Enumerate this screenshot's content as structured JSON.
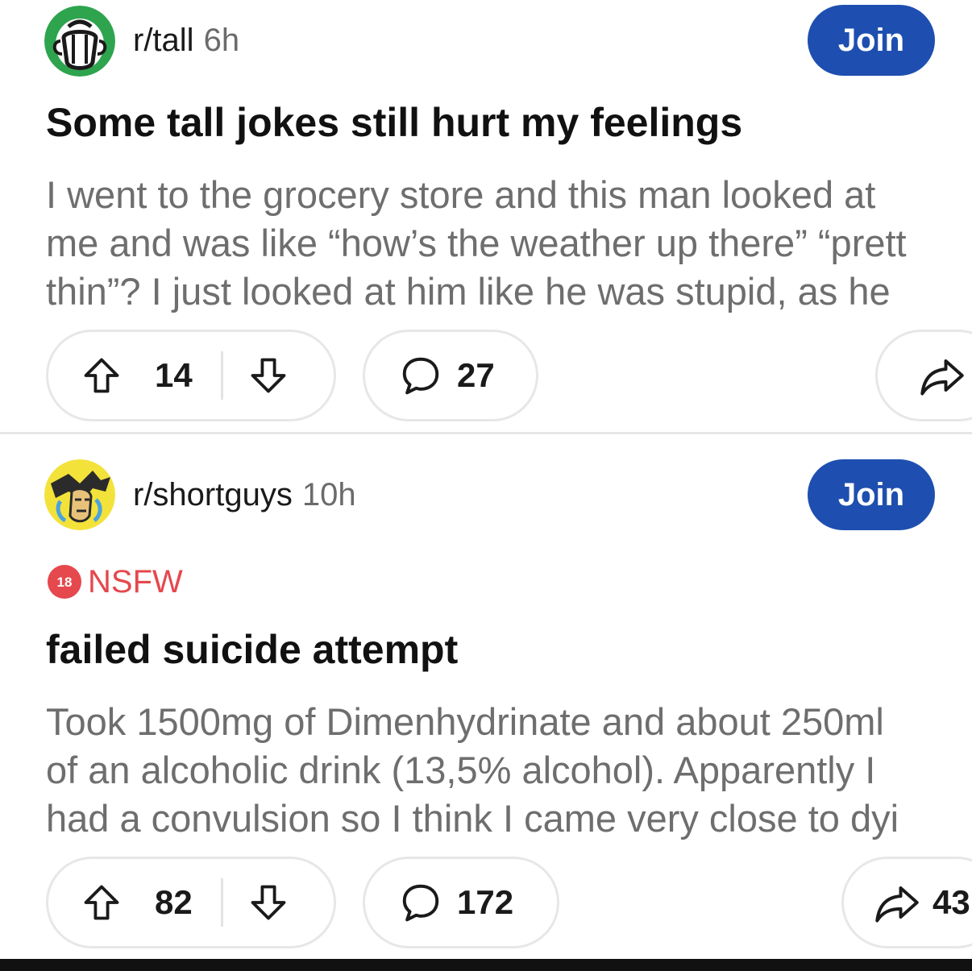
{
  "posts": [
    {
      "subreddit": "r/tall",
      "time": "6h",
      "join_label": "Join",
      "title": "Some tall jokes still hurt my feelings",
      "body_lines": [
        "I went to the grocery store and this man looked at",
        "me and was like “how’s the weather up there” “prett",
        "thin”? I just looked at him like he was stupid, as he"
      ],
      "upvotes": "14",
      "comments": "27",
      "shares": ""
    },
    {
      "subreddit": "r/shortguys",
      "time": "10h",
      "join_label": "Join",
      "nsfw_badge": "18",
      "nsfw_label": "NSFW",
      "title": "failed suicide attempt",
      "body_lines": [
        "Took 1500mg of Dimenhydrinate and about 250ml",
        "of an alcoholic drink (13,5% alcohol). Apparently I",
        "had a convulsion so I think I came very close to dyi"
      ],
      "upvotes": "82",
      "comments": "172",
      "shares": "43"
    }
  ],
  "colors": {
    "join_button": "#1e4fb0",
    "nsfw": "#e5484d",
    "body_text": "#6e6e6e",
    "pill_border": "#e7e7e7"
  },
  "icons": {
    "upvote": "arrow-up-outline",
    "downvote": "arrow-down-outline",
    "comment": "speech-bubble-outline",
    "share": "share-arrow-outline"
  }
}
